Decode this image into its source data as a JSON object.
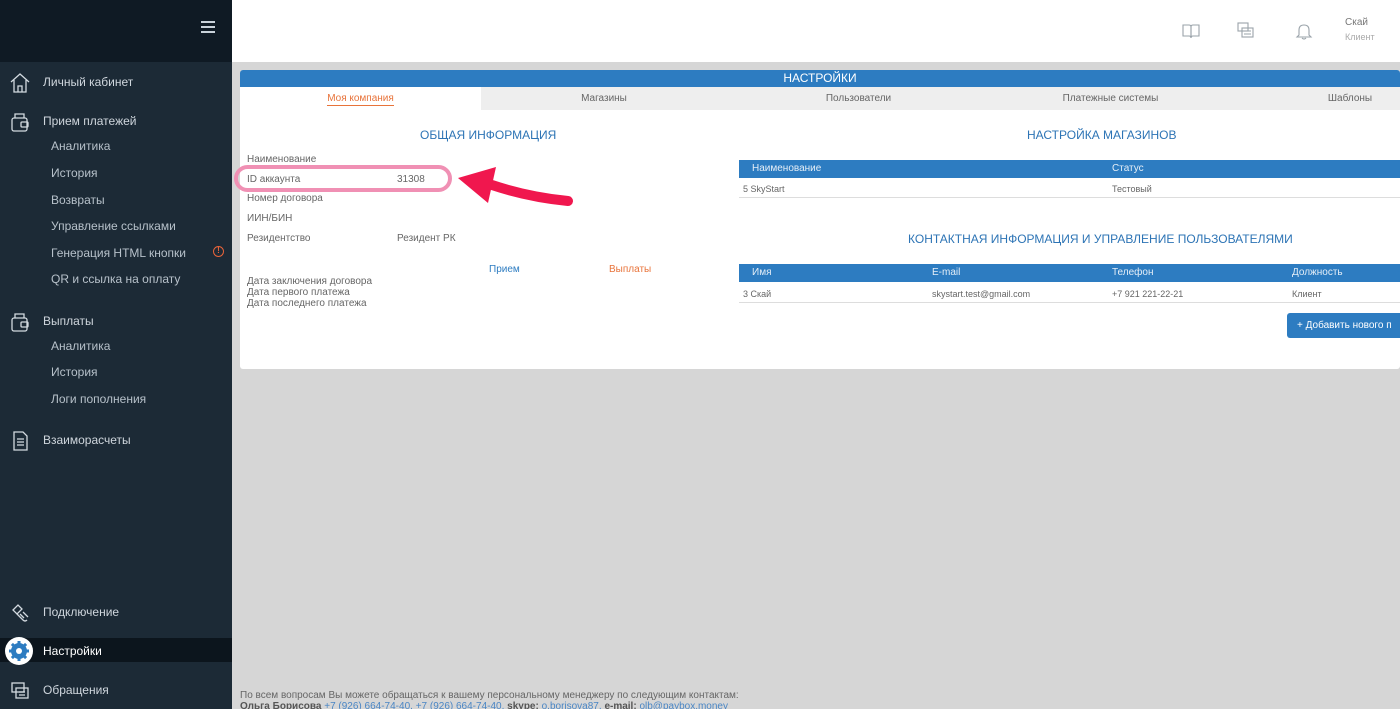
{
  "sidebar": {
    "menu_icon": "hamburger-icon",
    "items": [
      {
        "label": "Личный кабинет",
        "icon": "home-icon"
      },
      {
        "label": "Прием платежей",
        "icon": "wallet-icon",
        "children": [
          "Аналитика",
          "История",
          "Возвраты",
          "Управление ссылками",
          "Генерация HTML кнопки",
          "QR и ссылка на оплату"
        ]
      },
      {
        "label": "Выплаты",
        "icon": "wallet-icon",
        "children": [
          "Аналитика",
          "История",
          "Логи пополнения"
        ]
      },
      {
        "label": "Взаиморасчеты",
        "icon": "document-icon"
      },
      {
        "label": "Подключение",
        "icon": "plug-icon"
      },
      {
        "label": "Настройки",
        "icon": "gear-icon",
        "active": true
      },
      {
        "label": "Обращения",
        "icon": "chat-icon"
      }
    ],
    "warning_icon": "!"
  },
  "header": {
    "icons": [
      "book-icon",
      "chat-icon",
      "bell-icon"
    ],
    "user_name": "Скай",
    "user_role": "Клиент"
  },
  "settings": {
    "title": "НАСТРОЙКИ",
    "tabs": [
      "Моя компания",
      "Магазины",
      "Пользователи",
      "Платежные системы",
      "Шаблоны"
    ],
    "active_tab": "Моя компания"
  },
  "general_info": {
    "title": "ОБЩАЯ ИНФОРМАЦИЯ",
    "rows": [
      {
        "label": "Наименование",
        "value": ""
      },
      {
        "label": "ID аккаунта",
        "value": "31308"
      },
      {
        "label": "Номер договора",
        "value": ""
      },
      {
        "label": "ИИН/БИН",
        "value": ""
      },
      {
        "label": "Резидентство",
        "value": "Резидент РК"
      }
    ],
    "col_receive": "Прием",
    "col_payout": "Выплаты",
    "dates": [
      "Дата заключения договора",
      "Дата первого платежа",
      "Дата последнего платежа"
    ]
  },
  "stores": {
    "title": "НАСТРОЙКА МАГАЗИНОВ",
    "columns": [
      "Наименование",
      "Статус"
    ],
    "rows": [
      [
        "5 SkyStart",
        "Тестовый"
      ]
    ]
  },
  "contacts": {
    "title": "КОНТАКТНАЯ ИНФОРМАЦИЯ И УПРАВЛЕНИЕ ПОЛЬЗОВАТЕЛЯМИ",
    "columns": [
      "Имя",
      "E-mail",
      "Телефон",
      "Должность"
    ],
    "rows": [
      [
        "3 Скай",
        "skystart.test@gmail.com",
        "+7 921 221-22-21",
        "Клиент"
      ]
    ],
    "add_button": "+ Добавить нового п"
  },
  "annotation": {
    "highlight_color": "#f090b4",
    "arrow_color": "#f0174e"
  },
  "footer": {
    "line1": "По всем вопросам Вы можете обращаться к вашему персональному менеджеру по следующим контактам:",
    "manager": "Ольга Борисова",
    "phone1": "+7 (926) 664-74-40,",
    "phone2": "+7 (926) 664-74-40,",
    "skype_label": "skype:",
    "skype": "o.borisova87,",
    "email_label": "e-mail:",
    "email": "olb@paybox.money"
  },
  "colors": {
    "accent": "#2d7cc1",
    "sidebar": "#1c2a36",
    "active_tab": "#e8733a"
  }
}
